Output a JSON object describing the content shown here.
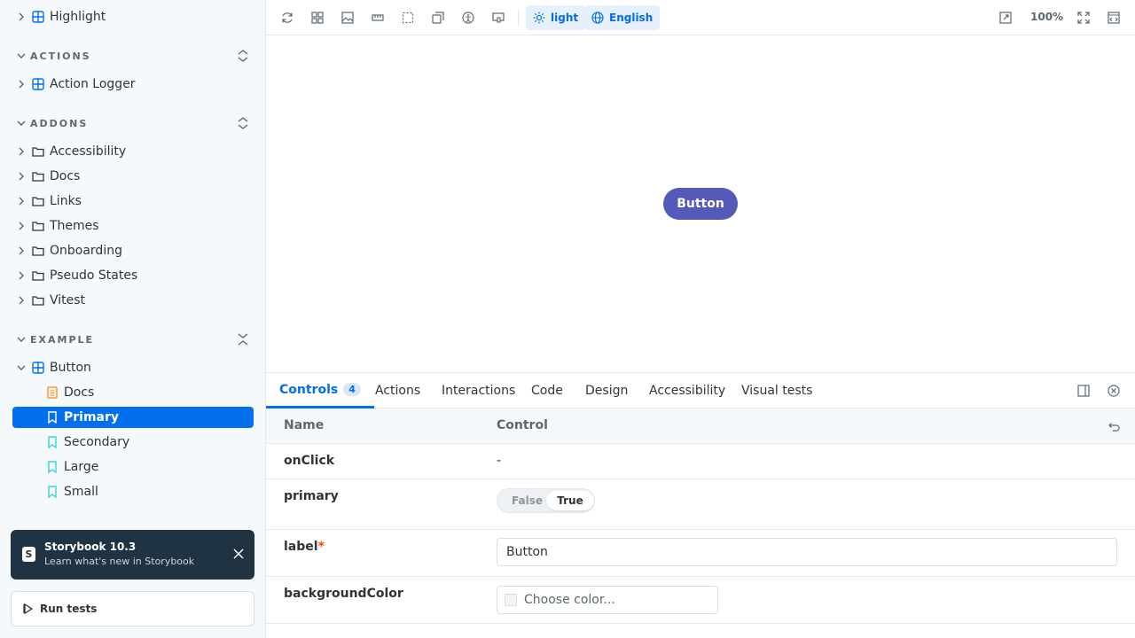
{
  "sidebar": {
    "top_item": {
      "label": "Highlight"
    },
    "sections": [
      {
        "title": "ACTIONS",
        "items": [
          "Action Logger"
        ]
      },
      {
        "title": "ADDONS",
        "items": [
          "Accessibility",
          "Docs",
          "Links",
          "Themes",
          "Onboarding",
          "Pseudo States",
          "Vitest"
        ]
      },
      {
        "title": "EXAMPLE"
      }
    ],
    "example": {
      "component": "Button",
      "stories": [
        "Docs",
        "Primary",
        "Secondary",
        "Large",
        "Small"
      ],
      "selected": "Primary"
    },
    "toast": {
      "title": "Storybook 10.3",
      "subtitle": "Learn what's new in Storybook"
    },
    "run_tests": "Run tests"
  },
  "toolbar": {
    "theme": "light",
    "locale": "English",
    "zoom": "100%",
    "accent": "#026fed"
  },
  "preview": {
    "button_label": "Button",
    "button_color": "#555ab9"
  },
  "panel": {
    "tabs": [
      "Controls",
      "Actions",
      "Interactions",
      "Code",
      "Design",
      "Accessibility",
      "Visual tests"
    ],
    "controls_count": "4",
    "header": {
      "name": "Name",
      "control": "Control"
    },
    "rows": {
      "onclick": {
        "name": "onClick",
        "value": "-"
      },
      "primary": {
        "name": "primary",
        "false_label": "False",
        "true_label": "True"
      },
      "label": {
        "name": "label",
        "required": "*",
        "value": "Button"
      },
      "background": {
        "name": "backgroundColor",
        "placeholder": "Choose color..."
      }
    }
  }
}
